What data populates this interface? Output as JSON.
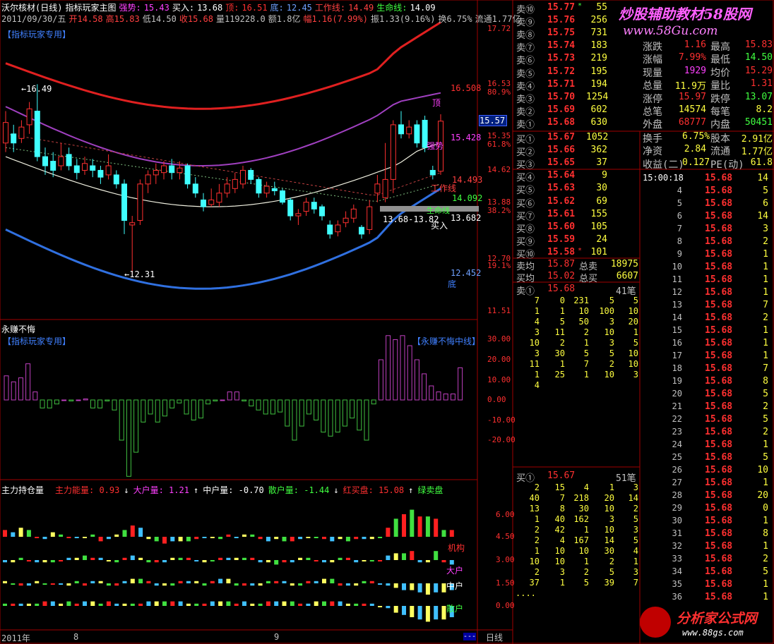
{
  "header": {
    "line1": [
      {
        "text": "沃尔核材(日线)",
        "color": "#ffffff"
      },
      {
        "text": "指标玩家主图",
        "color": "#ffffff"
      },
      {
        "text": "强势:",
        "color": "#ff40ff"
      },
      {
        "text": "15.43",
        "color": "#ff40ff"
      },
      {
        "text": "买入:",
        "color": "#ffffff"
      },
      {
        "text": "13.68",
        "color": "#ffffff"
      },
      {
        "text": "顶:",
        "color": "#ff3030"
      },
      {
        "text": "16.51",
        "color": "#ff3030"
      },
      {
        "text": "底:",
        "color": "#6fa0ff"
      },
      {
        "text": "12.45",
        "color": "#6fa0ff"
      },
      {
        "text": "工作线:",
        "color": "#ff4040"
      },
      {
        "text": "14.49",
        "color": "#ff4040"
      },
      {
        "text": "生命线:",
        "color": "#40ff40"
      },
      {
        "text": "14.09",
        "color": "#ffffff"
      }
    ],
    "line2": [
      {
        "text": "2011/09/30/五",
        "color": "#c0c0c0"
      },
      {
        "text": "开14.58",
        "color": "#ff4040"
      },
      {
        "text": "高15.83",
        "color": "#ff4040"
      },
      {
        "text": "低14.50",
        "color": "#c0c0c0"
      },
      {
        "text": "收15.68",
        "color": "#ff4040"
      },
      {
        "text": "量119228.0",
        "color": "#c0c0c0"
      },
      {
        "text": "额1.8亿",
        "color": "#c0c0c0"
      },
      {
        "text": "幅1.16(7.99%)",
        "color": "#ff4040"
      },
      {
        "text": "振1.33(9.16%)",
        "color": "#c0c0c0"
      },
      {
        "text": "换6.75%",
        "color": "#c0c0c0"
      },
      {
        "text": "流通1.77亿",
        "color": "#c0c0c0"
      }
    ],
    "indicator_tag": "【指标玩家专用】"
  },
  "main_chart": {
    "labels": {
      "high_mark": "16.49",
      "low_mark": "12.31",
      "ding": "顶",
      "di": "底",
      "qiangshi": "强势",
      "gongzuoxian": "工作线",
      "shengmingxian": "生命线",
      "mairu": "买入",
      "buy_range": "13.68-13.82"
    },
    "right_axis": [
      "17.72",
      "16.53",
      "80.9%",
      "15.35",
      "61.8%",
      "14.62",
      "13.88",
      "38.2%",
      "12.70",
      "19.1%",
      "11.51"
    ],
    "value_tags": {
      "top": "16.508",
      "qiangshi": "15.428",
      "gongzuo": "14.493",
      "shengming": "14.092",
      "mairu": "13.682",
      "di": "12.452",
      "last_price": "15.57"
    }
  },
  "osc_panel": {
    "title": "永赚不悔",
    "tag": "【指标玩家专用】",
    "tag2": "【永赚不悔中线】",
    "axis": [
      "30.00",
      "20.00",
      "10.00",
      "0.00",
      "-10.00",
      "-20.00"
    ],
    "colors": {
      "pos": "#c040c0",
      "neg": "#40c040"
    }
  },
  "vol_panel": {
    "title": "主力持仓量",
    "items": [
      {
        "text": "主力能量: 0.93",
        "color": "#ff3030"
      },
      {
        "text": "↓",
        "color": "#ffffff"
      },
      {
        "text": "大户量: 1.21",
        "color": "#ff40ff"
      },
      {
        "text": "↑",
        "color": "#ffffff"
      },
      {
        "text": "中户量: -0.70",
        "color": "#ffffff"
      },
      {
        "text": "散户量: -1.44",
        "color": "#40ff40"
      },
      {
        "text": "↓",
        "color": "#ffffff"
      },
      {
        "text": "红买盘: 15.08",
        "color": "#ff3030"
      },
      {
        "text": "↑",
        "color": "#ffffff"
      },
      {
        "text": "绿卖盘",
        "color": "#40ff40"
      }
    ],
    "axis": [
      "6.00",
      "4.50",
      "3.00",
      "1.50",
      "0.00"
    ],
    "labels": {
      "jigou": "机构",
      "dahu": "大户",
      "zhonghu": "中户",
      "sanhu": "散户"
    }
  },
  "bottom_axis": {
    "year": "2011年",
    "m8": "8",
    "m9": "9",
    "cycle_button": "日线",
    "more_button": "---"
  },
  "order_book": {
    "asks": [
      {
        "label": "卖⑩",
        "price": "15.77",
        "flag": "*",
        "vol": "55"
      },
      {
        "label": "卖⑨",
        "price": "15.76",
        "flag": "",
        "vol": "256"
      },
      {
        "label": "卖⑧",
        "price": "15.75",
        "flag": "",
        "vol": "731"
      },
      {
        "label": "卖⑦",
        "price": "15.74",
        "flag": "",
        "vol": "183"
      },
      {
        "label": "卖⑥",
        "price": "15.73",
        "flag": "",
        "vol": "219"
      },
      {
        "label": "卖⑤",
        "price": "15.72",
        "flag": "",
        "vol": "195"
      },
      {
        "label": "卖④",
        "price": "15.71",
        "flag": "",
        "vol": "194"
      },
      {
        "label": "卖③",
        "price": "15.70",
        "flag": "",
        "vol": "1254"
      },
      {
        "label": "卖②",
        "price": "15.69",
        "flag": "",
        "vol": "602"
      },
      {
        "label": "卖①",
        "price": "15.68",
        "flag": "",
        "vol": "630"
      }
    ],
    "bids": [
      {
        "label": "买①",
        "price": "15.67",
        "flag": "",
        "vol": "1052"
      },
      {
        "label": "买②",
        "price": "15.66",
        "flag": "",
        "vol": "362"
      },
      {
        "label": "买③",
        "price": "15.65",
        "flag": "",
        "vol": "37"
      },
      {
        "label": "买④",
        "price": "15.64",
        "flag": "",
        "vol": "9"
      },
      {
        "label": "买⑤",
        "price": "15.63",
        "flag": "",
        "vol": "30"
      },
      {
        "label": "买⑥",
        "price": "15.62",
        "flag": "",
        "vol": "69"
      },
      {
        "label": "买⑦",
        "price": "15.61",
        "flag": "",
        "vol": "155"
      },
      {
        "label": "买⑧",
        "price": "15.60",
        "flag": "",
        "vol": "105"
      },
      {
        "label": "买⑨",
        "price": "15.59",
        "flag": "",
        "vol": "24"
      },
      {
        "label": "买⑩",
        "price": "15.58",
        "flag": "*",
        "vol": "101"
      }
    ],
    "summary": [
      {
        "l1": "卖均",
        "v1": "15.87",
        "l2": "总卖",
        "v2": "18975"
      },
      {
        "l1": "买均",
        "v1": "15.02",
        "l2": "总买",
        "v2": "6607"
      }
    ],
    "sell1_queue": {
      "label": "卖①",
      "price": "15.68",
      "count": "41笔"
    },
    "sell1_rows": [
      [
        "7",
        "0",
        "231",
        "5",
        "5"
      ],
      [
        "1",
        "1",
        "10",
        "100",
        "10"
      ],
      [
        "4",
        "5",
        "50",
        "3",
        "20"
      ],
      [
        "3",
        "11",
        "2",
        "10",
        "1"
      ],
      [
        "10",
        "2",
        "1",
        "3",
        "5"
      ],
      [
        "3",
        "30",
        "5",
        "5",
        "10"
      ],
      [
        "11",
        "1",
        "7",
        "2",
        "10"
      ],
      [
        "1",
        "25",
        "1",
        "10",
        "3"
      ],
      [
        "4",
        "",
        "",
        "",
        ""
      ]
    ],
    "buy1_queue": {
      "label": "买①",
      "price": "15.67",
      "count": "51笔"
    },
    "buy1_rows": [
      [
        "2",
        "15",
        "4",
        "1",
        "3"
      ],
      [
        "40",
        "7",
        "218",
        "20",
        "14"
      ],
      [
        "13",
        "8",
        "30",
        "10",
        "2"
      ],
      [
        "1",
        "40",
        "162",
        "3",
        "5"
      ],
      [
        "2",
        "42",
        "1",
        "10",
        "3"
      ],
      [
        "2",
        "4",
        "167",
        "14",
        "5"
      ],
      [
        "1",
        "10",
        "10",
        "30",
        "4"
      ],
      [
        "10",
        "10",
        "1",
        "2",
        "1"
      ],
      [
        "2",
        "3",
        "2",
        "5",
        "3"
      ],
      [
        "37",
        "1",
        "5",
        "39",
        "7"
      ],
      [
        "....",
        "",
        "",
        "",
        ""
      ]
    ]
  },
  "quote_panel": {
    "watermark1": "炒股辅助教材58股网",
    "watermark2": "www.58Gu.com",
    "rows": [
      {
        "l1": "涨跌",
        "v1": "1.16",
        "l2": "最高",
        "v2": "15.83",
        "c1": "#ff3030",
        "c2": "#ff3030"
      },
      {
        "l1": "涨幅",
        "v1": "7.99%",
        "l2": "最低",
        "v2": "14.50",
        "c1": "#ff3030",
        "c2": "#40ff40"
      },
      {
        "l1": "现量",
        "v1": "1929",
        "l2": "均价",
        "v2": "15.29",
        "c1": "#ff40ff",
        "c2": "#ff3030"
      },
      {
        "l1": "总量",
        "v1": "11.9万",
        "l2": "量比",
        "v2": "1.31",
        "c1": "#ffff40",
        "c2": "#ff3030"
      },
      {
        "l1": "涨停",
        "v1": "15.97",
        "l2": "跌停",
        "v2": "13.07",
        "c1": "#ff3030",
        "c2": "#40ff40"
      },
      {
        "l1": "总笔",
        "v1": "14574",
        "l2": "每笔",
        "v2": "8.2",
        "c1": "#ffff40",
        "c2": "#ffff40"
      },
      {
        "l1": "外盘",
        "v1": "68777",
        "l2": "内盘",
        "v2": "50451",
        "c1": "#ff3030",
        "c2": "#40ff40"
      }
    ],
    "rows2": [
      {
        "l1": "换手",
        "v1": "6.75%",
        "l2": "股本",
        "v2": "2.91亿"
      },
      {
        "l1": "净资",
        "v1": "2.84",
        "l2": "流通",
        "v2": "1.77亿"
      },
      {
        "l1": "收益(二)",
        "v1": "0.127",
        "l2": "PE(动)",
        "v2": "61.8"
      }
    ]
  },
  "tick_list": {
    "first_time": "15:00:18",
    "rows": [
      [
        "15:00:18",
        "15.68",
        "14"
      ],
      [
        "4",
        "15.68",
        "5"
      ],
      [
        "5",
        "15.68",
        "6"
      ],
      [
        "6",
        "15.68",
        "14"
      ],
      [
        "7",
        "15.68",
        "3"
      ],
      [
        "8",
        "15.68",
        "2"
      ],
      [
        "9",
        "15.68",
        "1"
      ],
      [
        "10",
        "15.68",
        "1"
      ],
      [
        "11",
        "15.68",
        "1"
      ],
      [
        "12",
        "15.68",
        "1"
      ],
      [
        "13",
        "15.68",
        "7"
      ],
      [
        "14",
        "15.68",
        "2"
      ],
      [
        "15",
        "15.68",
        "1"
      ],
      [
        "16",
        "15.68",
        "1"
      ],
      [
        "17",
        "15.68",
        "1"
      ],
      [
        "18",
        "15.68",
        "7"
      ],
      [
        "19",
        "15.68",
        "8"
      ],
      [
        "20",
        "15.68",
        "5"
      ],
      [
        "21",
        "15.68",
        "2"
      ],
      [
        "22",
        "15.68",
        "5"
      ],
      [
        "23",
        "15.68",
        "2"
      ],
      [
        "24",
        "15.68",
        "1"
      ],
      [
        "25",
        "15.68",
        "5"
      ],
      [
        "26",
        "15.68",
        "10"
      ],
      [
        "27",
        "15.68",
        "1"
      ],
      [
        "28",
        "15.68",
        "20"
      ],
      [
        "29",
        "15.68",
        "0"
      ],
      [
        "30",
        "15.68",
        "1"
      ],
      [
        "31",
        "15.68",
        "8"
      ],
      [
        "32",
        "15.68",
        "1"
      ],
      [
        "33",
        "15.68",
        "2"
      ],
      [
        "34",
        "15.68",
        "5"
      ],
      [
        "35",
        "15.68",
        "1"
      ],
      [
        "36",
        "15.68",
        "1"
      ]
    ],
    "logo1": "分析家公式网",
    "logo2": "www.88gs.com"
  },
  "colors": {
    "up": "#ff3030",
    "down": "#40ffff",
    "panel_border": "#a00000",
    "top_line": "#e02020",
    "bottom_line": "#3070e0",
    "mid_line": "#a040c0",
    "life_line": "#f0f0e0"
  },
  "candles": [
    {
      "o": 15.2,
      "c": 15.65,
      "h": 15.9,
      "l": 15.0
    },
    {
      "o": 15.4,
      "c": 15.2,
      "h": 15.6,
      "l": 15.0
    },
    {
      "o": 15.3,
      "c": 15.55,
      "h": 15.7,
      "l": 15.2
    },
    {
      "o": 15.6,
      "c": 15.95,
      "h": 16.1,
      "l": 15.4
    },
    {
      "o": 15.9,
      "c": 14.9,
      "h": 16.49,
      "l": 14.8
    },
    {
      "o": 14.9,
      "c": 14.7,
      "h": 15.1,
      "l": 14.5
    },
    {
      "o": 14.8,
      "c": 14.6,
      "h": 15.0,
      "l": 14.45
    },
    {
      "o": 14.7,
      "c": 14.9,
      "h": 15.2,
      "l": 14.6
    },
    {
      "o": 14.95,
      "c": 14.7,
      "h": 15.1,
      "l": 14.6
    },
    {
      "o": 14.7,
      "c": 14.55,
      "h": 14.85,
      "l": 14.4
    },
    {
      "o": 14.6,
      "c": 14.75,
      "h": 14.9,
      "l": 14.5
    },
    {
      "o": 14.7,
      "c": 14.6,
      "h": 14.85,
      "l": 14.45
    },
    {
      "o": 14.6,
      "c": 14.45,
      "h": 14.7,
      "l": 14.3
    },
    {
      "o": 14.5,
      "c": 14.7,
      "h": 14.95,
      "l": 14.4
    },
    {
      "o": 14.5,
      "c": 14.3,
      "h": 14.6,
      "l": 14.2
    },
    {
      "o": 14.3,
      "c": 13.5,
      "h": 14.4,
      "l": 13.2
    },
    {
      "o": 13.4,
      "c": 13.45,
      "h": 13.6,
      "l": 12.31
    },
    {
      "o": 13.5,
      "c": 14.3,
      "h": 14.4,
      "l": 13.4
    },
    {
      "o": 14.3,
      "c": 14.5,
      "h": 14.6,
      "l": 14.1
    },
    {
      "o": 14.5,
      "c": 14.6,
      "h": 14.75,
      "l": 14.3
    },
    {
      "o": 14.55,
      "c": 14.7,
      "h": 14.8,
      "l": 14.4
    },
    {
      "o": 14.7,
      "c": 14.55,
      "h": 14.85,
      "l": 14.4
    },
    {
      "o": 14.55,
      "c": 14.65,
      "h": 14.8,
      "l": 14.4
    },
    {
      "o": 14.7,
      "c": 14.3,
      "h": 14.75,
      "l": 14.2
    },
    {
      "o": 14.3,
      "c": 14.1,
      "h": 14.45,
      "l": 14.0
    },
    {
      "o": 13.95,
      "c": 13.8,
      "h": 14.1,
      "l": 13.7
    },
    {
      "o": 13.85,
      "c": 13.95,
      "h": 14.2,
      "l": 13.8
    },
    {
      "o": 13.9,
      "c": 14.1,
      "h": 14.3,
      "l": 13.8
    },
    {
      "o": 14.1,
      "c": 14.3,
      "h": 14.45,
      "l": 14.0
    },
    {
      "o": 14.2,
      "c": 14.4,
      "h": 14.55,
      "l": 14.1
    },
    {
      "o": 14.3,
      "c": 14.6,
      "h": 14.7,
      "l": 14.2
    },
    {
      "o": 14.6,
      "c": 14.4,
      "h": 14.65,
      "l": 14.3
    },
    {
      "o": 14.4,
      "c": 14.1,
      "h": 14.45,
      "l": 14.0
    },
    {
      "o": 14.1,
      "c": 14.25,
      "h": 14.35,
      "l": 14.0
    },
    {
      "o": 14.2,
      "c": 14.15,
      "h": 14.35,
      "l": 14.05
    },
    {
      "o": 14.15,
      "c": 13.9,
      "h": 14.2,
      "l": 13.85
    },
    {
      "o": 13.95,
      "c": 13.6,
      "h": 14.0,
      "l": 13.5
    },
    {
      "o": 13.6,
      "c": 13.65,
      "h": 13.75,
      "l": 13.4
    },
    {
      "o": 13.7,
      "c": 13.9,
      "h": 14.0,
      "l": 13.6
    },
    {
      "o": 13.9,
      "c": 13.75,
      "h": 14.0,
      "l": 13.65
    },
    {
      "o": 13.8,
      "c": 13.6,
      "h": 13.85,
      "l": 13.5
    },
    {
      "o": 13.4,
      "c": 13.2,
      "h": 13.5,
      "l": 13.1
    },
    {
      "o": 13.25,
      "c": 13.4,
      "h": 13.5,
      "l": 13.15
    },
    {
      "o": 13.45,
      "c": 13.55,
      "h": 13.7,
      "l": 13.35
    },
    {
      "o": 13.55,
      "c": 13.75,
      "h": 13.85,
      "l": 13.45
    },
    {
      "o": 13.35,
      "c": 13.2,
      "h": 13.4,
      "l": 13.1
    },
    {
      "o": 13.3,
      "c": 13.8,
      "h": 13.95,
      "l": 13.2
    },
    {
      "o": 14.1,
      "c": 14.3,
      "h": 14.5,
      "l": 13.9
    },
    {
      "o": 14.0,
      "c": 14.4,
      "h": 15.2,
      "l": 13.9
    },
    {
      "o": 14.4,
      "c": 15.6,
      "h": 15.7,
      "l": 14.1
    },
    {
      "o": 15.6,
      "c": 15.4,
      "h": 15.9,
      "l": 15.3
    },
    {
      "o": 15.4,
      "c": 15.55,
      "h": 15.7,
      "l": 15.3
    },
    {
      "o": 15.6,
      "c": 15.2,
      "h": 15.7,
      "l": 15.1
    },
    {
      "o": 15.7,
      "c": 15.1,
      "h": 15.8,
      "l": 15.0
    },
    {
      "o": 14.6,
      "c": 14.5,
      "h": 14.7,
      "l": 14.4
    },
    {
      "o": 14.58,
      "c": 15.68,
      "h": 15.83,
      "l": 14.5
    }
  ],
  "osc_values": [
    12,
    9,
    11,
    18,
    4,
    -4,
    -4,
    -2,
    0,
    -0.5,
    0,
    0.5,
    -4,
    -4,
    -0.5,
    -5,
    -20,
    -38,
    -26,
    -11,
    -7,
    -11,
    -8,
    -4,
    -1.5,
    -7,
    -10,
    -9,
    -2,
    -0.5,
    0,
    4,
    4,
    -0.5,
    -3,
    -5,
    -7,
    -7,
    -6,
    -13,
    -20,
    -13,
    -7,
    -10,
    -16,
    -18,
    -16,
    -13,
    -9,
    -15,
    -20,
    -2,
    20,
    32,
    30,
    32,
    27,
    20,
    13,
    7,
    4,
    3,
    3,
    16
  ],
  "vol_rows": [
    {
      "base": 4.5,
      "vals": [
        3,
        2,
        4,
        3,
        0,
        -1,
        2,
        1,
        0,
        0,
        0,
        1,
        -2,
        -1,
        1,
        3,
        5,
        4,
        -1,
        -2,
        -3,
        -2,
        -2,
        -2,
        -1,
        0,
        0,
        -1,
        1,
        0,
        1,
        1,
        -1,
        -2,
        -1,
        -2,
        -2,
        -1,
        0,
        0,
        -1,
        -2,
        -1,
        -2,
        -1,
        -1,
        -1,
        0,
        4,
        8,
        10,
        12,
        9,
        9,
        8,
        3,
        3
      ]
    },
    {
      "base": 3.0,
      "vals": [
        -1,
        -1,
        1,
        0,
        -1,
        -1,
        -1,
        0,
        1,
        1,
        2,
        1,
        1,
        0,
        -1,
        1,
        2,
        1,
        -1,
        -1,
        -1,
        1,
        1,
        1,
        0,
        -1,
        0,
        1,
        1,
        1,
        1,
        1,
        -1,
        -1,
        -2,
        -1,
        -1,
        1,
        1,
        0,
        -1,
        -1,
        1,
        1,
        -1,
        0,
        0,
        0,
        2,
        3,
        3,
        4,
        -1,
        -1,
        4,
        -1,
        -2
      ]
    },
    {
      "base": 1.5,
      "vals": [
        1,
        0,
        -1,
        -1,
        1,
        0,
        0,
        0,
        -1,
        1,
        -1,
        1,
        1,
        -1,
        -1,
        1,
        2,
        2,
        1,
        -1,
        -1,
        -1,
        1,
        1,
        1,
        -1,
        1,
        2,
        2,
        -1,
        -1,
        -1,
        -1,
        1,
        1,
        1,
        -1,
        -1,
        1,
        1,
        2,
        2,
        -1,
        -1,
        -1,
        1,
        1,
        0,
        -1,
        -2,
        -3,
        -3,
        -4,
        -5,
        -4,
        -4,
        -3
      ]
    },
    {
      "base": 0.0,
      "vals": [
        1,
        1,
        1,
        1,
        1,
        2,
        2,
        1,
        2,
        1,
        2,
        2,
        1,
        2,
        1,
        1,
        1,
        1,
        2,
        2,
        2,
        2,
        2,
        1,
        1,
        1,
        2,
        2,
        2,
        1,
        2,
        1,
        1,
        2,
        2,
        2,
        2,
        1,
        1,
        2,
        2,
        2,
        2,
        1,
        1,
        1,
        1,
        0,
        -1,
        -3,
        -4,
        -5,
        -6,
        -7,
        -6,
        -6,
        -5
      ]
    }
  ]
}
